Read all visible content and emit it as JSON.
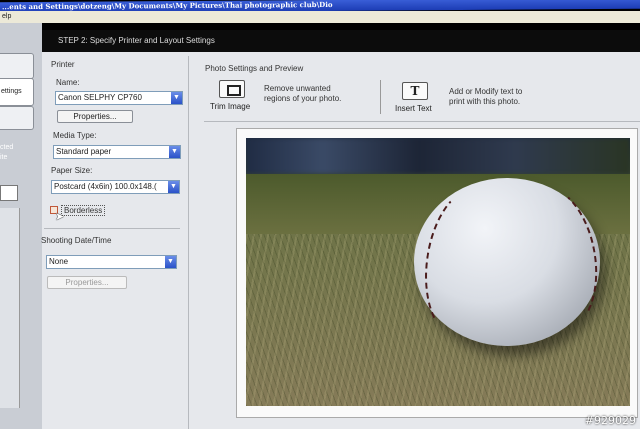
{
  "window": {
    "title": "...ents and Settings\\dotzeng\\My Documents\\My Pictures\\Thai photographic club\\Dio",
    "menu_help": "elp"
  },
  "step_header": "STEP 2: Specify Printer and Layout Settings",
  "sidebar": {
    "button_top": "",
    "button_settings": "ettings",
    "partial_text_1": "cted",
    "partial_text_2": "ite"
  },
  "printer": {
    "section_label": "Printer",
    "name_label": "Name:",
    "name_value": "Canon SELPHY CP760",
    "properties_button": "Properties...",
    "media_type_label": "Media Type:",
    "media_type_value": "Standard paper",
    "paper_size_label": "Paper Size:",
    "paper_size_value": "Postcard (4x6in) 100.0x148.(",
    "borderless_label": "Borderless",
    "borderless_checked": false
  },
  "shooting_date": {
    "section_label": "Shooting Date/Time",
    "value": "None",
    "properties_button": "Properties..."
  },
  "photo_settings": {
    "section_label": "Photo Settings and Preview",
    "trim": {
      "icon": "trim-image-icon",
      "label": "Trim Image",
      "desc_line1": "Remove unwanted",
      "desc_line2": "regions of your photo."
    },
    "insert_text": {
      "icon": "insert-text-icon",
      "label": "Insert Text",
      "desc_line1": "Add or Modify text to",
      "desc_line2": "print with this photo."
    }
  },
  "watermark": "#929029"
}
